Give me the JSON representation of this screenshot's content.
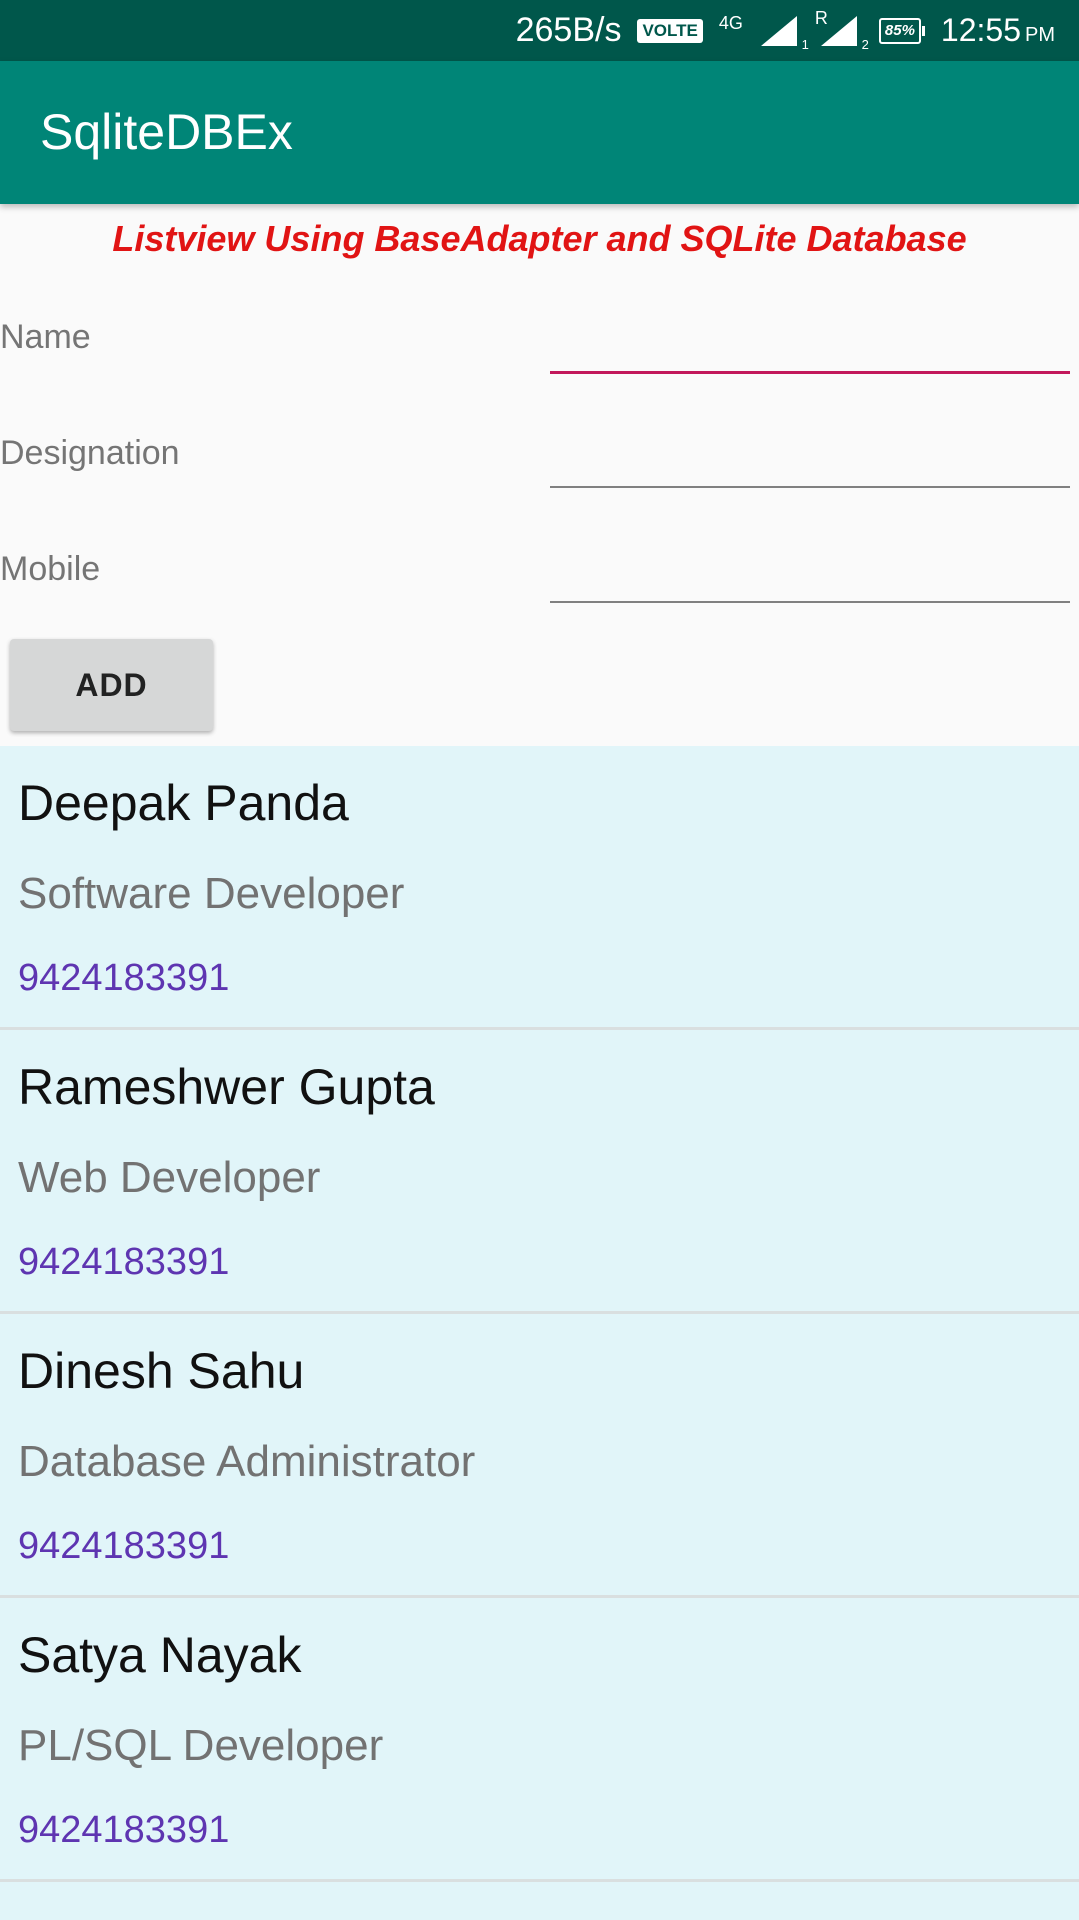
{
  "status_bar": {
    "net_speed": "265B/s",
    "volte": "VOLTE",
    "network": "4G",
    "sim1_sub": "1",
    "sim2_roam": "R",
    "sim2_sub": "2",
    "battery": "85%",
    "time": "12:55",
    "ampm": "PM"
  },
  "app_bar": {
    "title": "SqliteDBEx"
  },
  "heading": "Listview Using BaseAdapter and SQLite Database",
  "form": {
    "name_label": "Name",
    "name_value": "",
    "designation_label": "Designation",
    "designation_value": "",
    "mobile_label": "Mobile",
    "mobile_value": "",
    "add_button": "ADD"
  },
  "employees": [
    {
      "name": "Deepak Panda",
      "designation": "Software Developer",
      "mobile": "9424183391"
    },
    {
      "name": "Rameshwer Gupta",
      "designation": "Web Developer",
      "mobile": "9424183391"
    },
    {
      "name": "Dinesh Sahu",
      "designation": "Database Administrator",
      "mobile": "9424183391"
    },
    {
      "name": "Satya Nayak",
      "designation": "PL/SQL Developer",
      "mobile": "9424183391"
    }
  ],
  "colors": {
    "status_bar": "#00574b",
    "app_bar": "#008577",
    "heading": "#e11414",
    "accent_underline": "#c2185b",
    "list_bg": "#e1f5f9",
    "mobile_text": "#5e35b1"
  }
}
